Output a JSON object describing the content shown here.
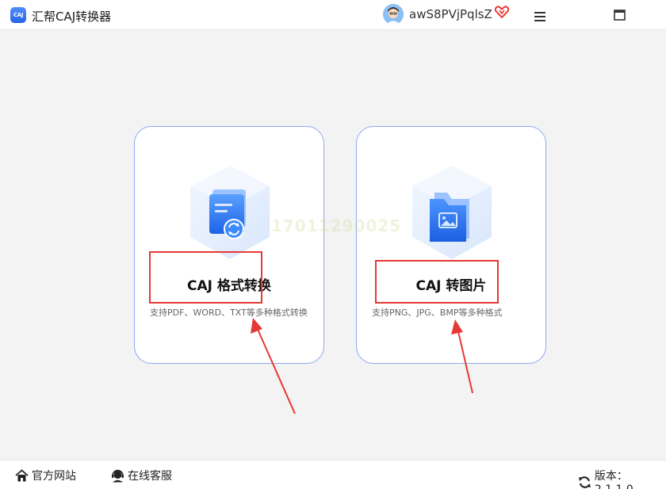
{
  "app": {
    "logo_text": "CAJ",
    "title": "汇帮CAJ转换器"
  },
  "user": {
    "name": "awS8PVjPqlsZ"
  },
  "icons": {
    "vip": "heart-vip-icon",
    "menu": "hamburger-menu-icon",
    "maximize": "maximize-icon",
    "close": "close-icon",
    "home": "home-icon",
    "service": "customer-service-icon",
    "refresh": "refresh-icon"
  },
  "cards": [
    {
      "title": "CAJ 格式转换",
      "desc": "支持PDF、WORD、TXT等多种格式转换"
    },
    {
      "title": "CAJ 转图片",
      "desc": "支持PNG、JPG、BMP等多种格式"
    }
  ],
  "watermark": "17011290025",
  "footer": {
    "site_label": "官方网站",
    "service_label": "在线客服",
    "version_label": "版本：2.1.1.0"
  },
  "colors": {
    "accent": "#2563eb",
    "card_border": "#8fa8f2",
    "highlight": "#e53935"
  }
}
